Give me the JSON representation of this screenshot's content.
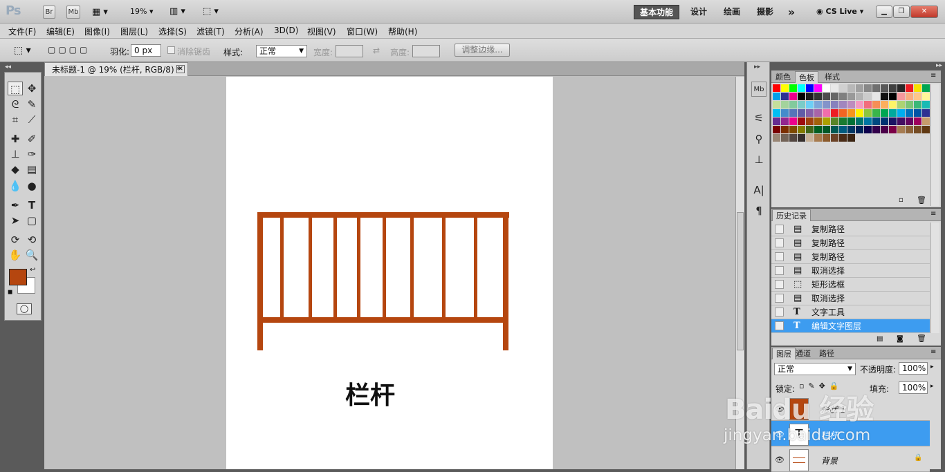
{
  "app": {
    "logo": "Ps",
    "bridge_btn": "Br",
    "minibridge_btn": "Mb",
    "zoom": "19%",
    "workspaces": [
      "基本功能",
      "设计",
      "绘画",
      "摄影"
    ],
    "more": "»",
    "cslive": "CS Live"
  },
  "menu": [
    "文件(F)",
    "编辑(E)",
    "图像(I)",
    "图层(L)",
    "选择(S)",
    "滤镜(T)",
    "分析(A)",
    "3D(D)",
    "视图(V)",
    "窗口(W)",
    "帮助(H)"
  ],
  "options": {
    "feather_label": "羽化:",
    "feather_value": "0 px",
    "antialias_label": "消除锯齿",
    "style_label": "样式:",
    "style_value": "正常",
    "width_label": "宽度:",
    "height_label": "高度:",
    "refine_edge": "调整边缘..."
  },
  "document": {
    "tab_title": "未标题-1 @ 19% (栏杆, RGB/8) *",
    "caption": "栏杆",
    "railing_color": "#b5460f"
  },
  "colors": {
    "foreground": "#b5460f",
    "background": "#ffffff",
    "selection": "#3d9cf0"
  },
  "swatches_panel": {
    "tabs": [
      "颜色",
      "色板",
      "样式"
    ],
    "active_tab": "色板"
  },
  "history_panel": {
    "title": "历史记录",
    "items": [
      {
        "label": "复制路径",
        "icon": "path"
      },
      {
        "label": "复制路径",
        "icon": "path"
      },
      {
        "label": "复制路径",
        "icon": "path"
      },
      {
        "label": "取消选择",
        "icon": "path"
      },
      {
        "label": "矩形选框",
        "icon": "marquee"
      },
      {
        "label": "取消选择",
        "icon": "path"
      },
      {
        "label": "文字工具",
        "icon": "text"
      },
      {
        "label": "编辑文字图层",
        "icon": "text"
      }
    ],
    "selected_index": 7
  },
  "layers_panel": {
    "tabs": [
      "图层",
      "通道",
      "路径"
    ],
    "blend_mode": "正常",
    "opacity_label": "不透明度:",
    "opacity_value": "100%",
    "lock_label": "锁定:",
    "fill_label": "填充:",
    "fill_value": "100%",
    "layers": [
      {
        "name": "形状 1",
        "type": "shape"
      },
      {
        "name": "栏杆",
        "type": "text",
        "selected": true
      },
      {
        "name": "背景",
        "type": "background"
      }
    ]
  },
  "watermark": {
    "line1": "Baidu 经验",
    "line2": "jingyan.baidu.com"
  }
}
